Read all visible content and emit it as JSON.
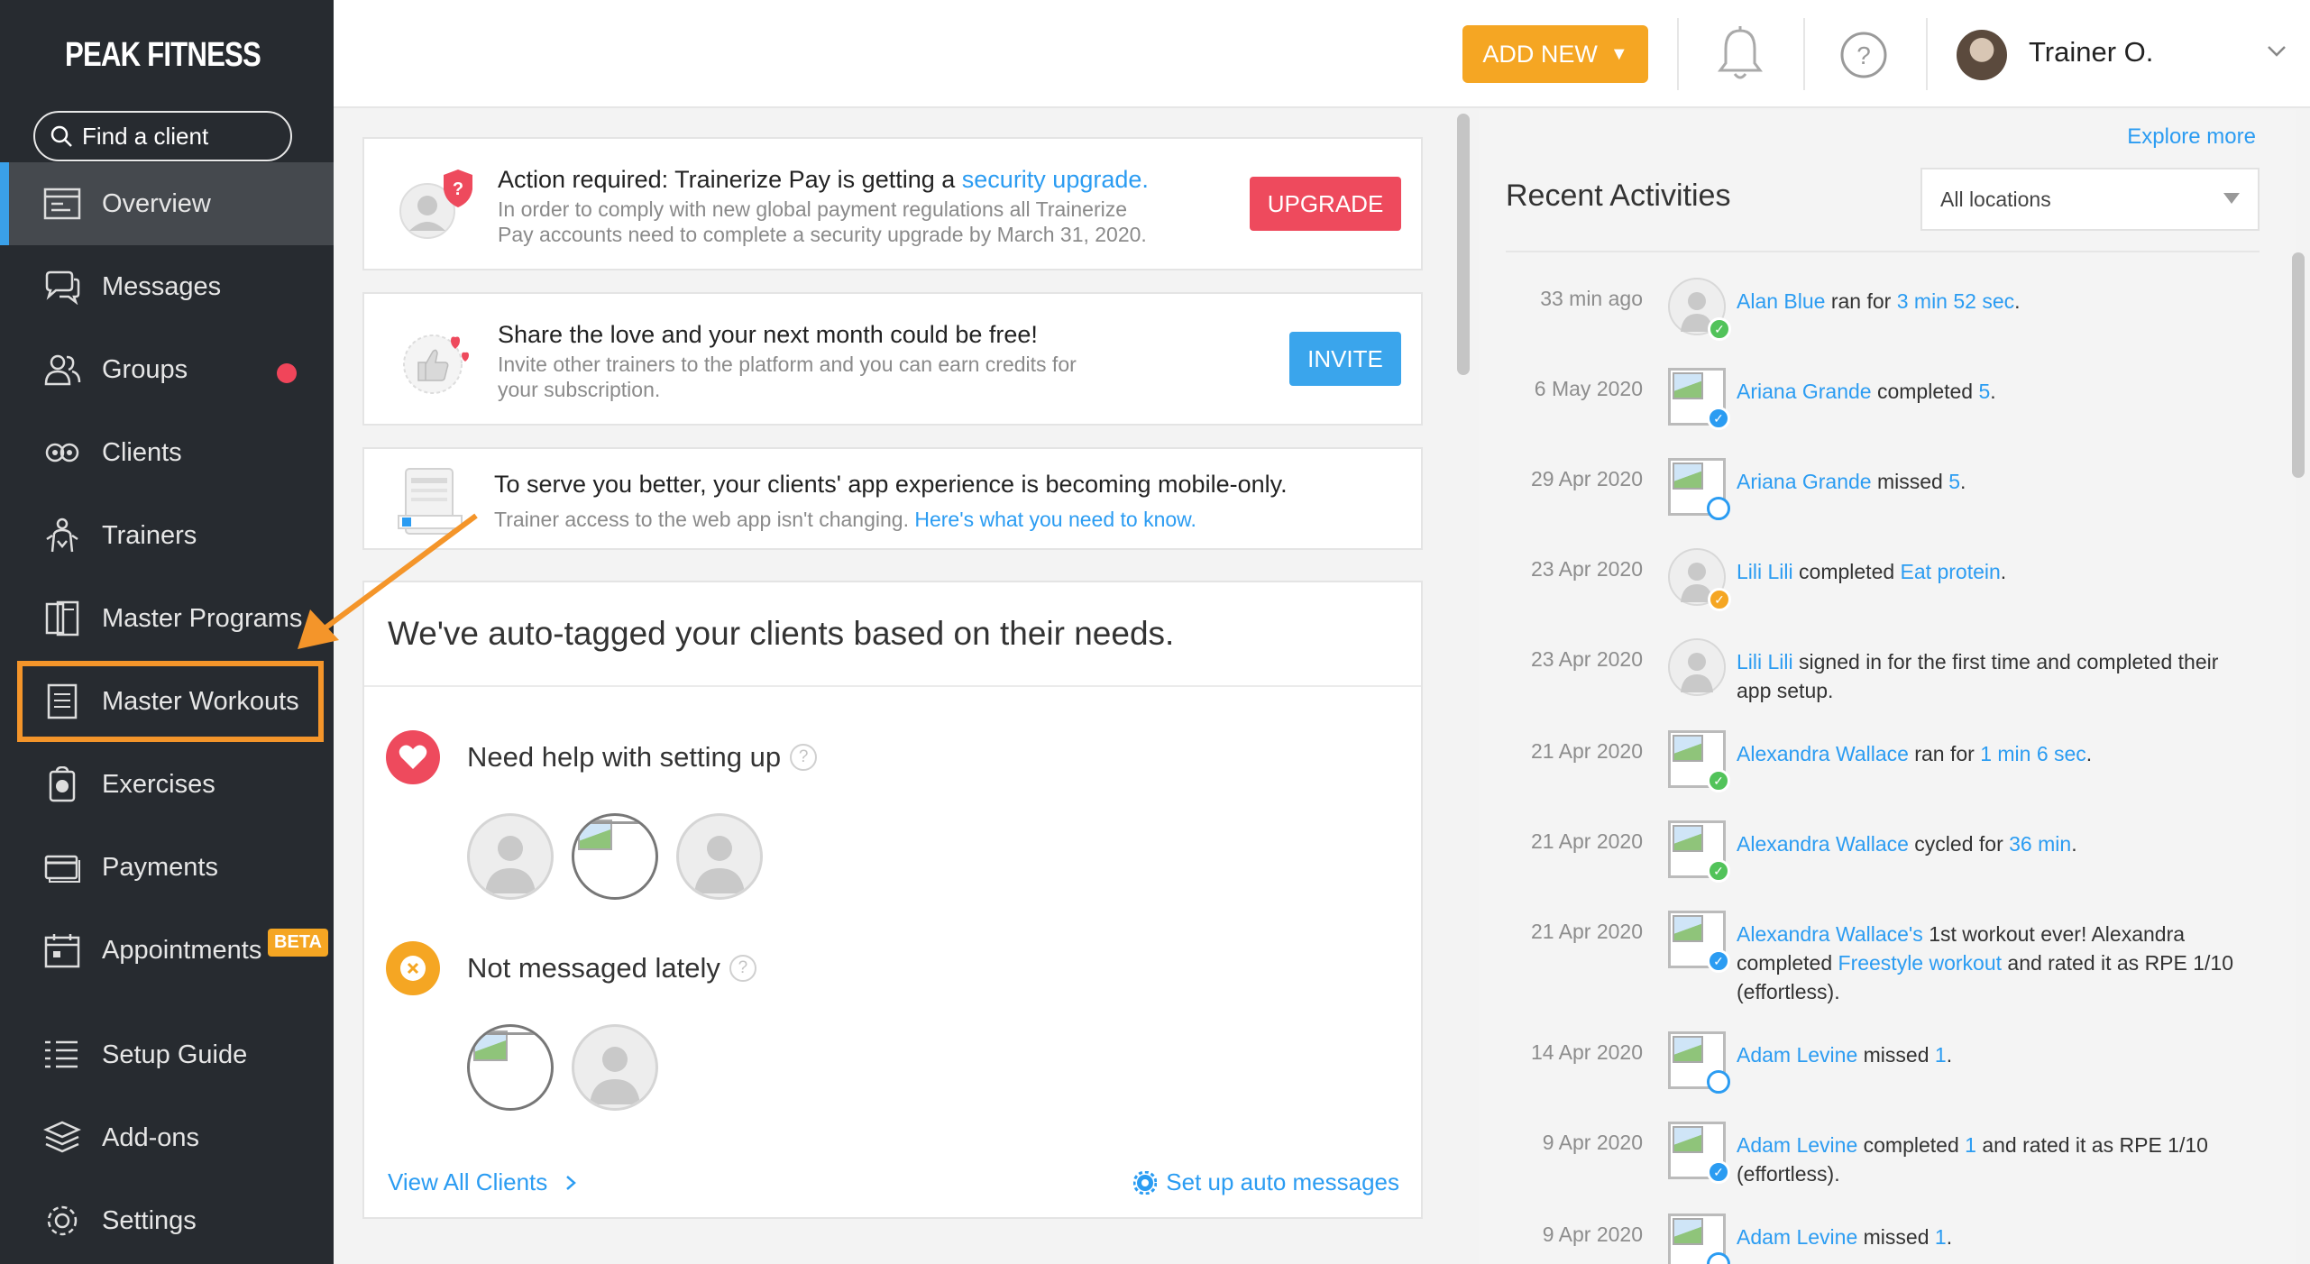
{
  "brand": {
    "name": "PEAK FITNESS",
    "color": "#e8423a"
  },
  "search": {
    "placeholder": "Find a client"
  },
  "sidebar": {
    "items": [
      {
        "label": "Overview",
        "icon": "overview-icon",
        "active": true
      },
      {
        "label": "Messages",
        "icon": "messages-icon"
      },
      {
        "label": "Groups",
        "icon": "groups-icon",
        "badge": "red-dot"
      },
      {
        "label": "Clients",
        "icon": "clients-icon"
      },
      {
        "label": "Trainers",
        "icon": "trainers-icon"
      },
      {
        "label": "Master Programs",
        "icon": "master-programs-icon"
      },
      {
        "label": "Master Workouts",
        "icon": "master-workouts-icon",
        "highlighted": true
      },
      {
        "label": "Exercises",
        "icon": "exercises-icon"
      },
      {
        "label": "Payments",
        "icon": "payments-icon"
      },
      {
        "label": "Appointments",
        "icon": "appointments-icon",
        "tag": "BETA"
      },
      {
        "label": "Setup Guide",
        "icon": "setup-guide-icon"
      },
      {
        "label": "Add-ons",
        "icon": "add-ons-icon"
      },
      {
        "label": "Settings",
        "icon": "settings-icon"
      }
    ]
  },
  "header": {
    "add_new": "ADD NEW",
    "user_name": "Trainer O."
  },
  "cards": {
    "pay": {
      "title_prefix": "Action required: Trainerize Pay is getting a ",
      "title_link": "security upgrade.",
      "sub_line1": "In order to comply with new global payment regulations all Trainerize",
      "sub_line2": "Pay accounts need to complete a security upgrade by March 31, 2020.",
      "button": "UPGRADE"
    },
    "share": {
      "title": "Share the love and your next month could be free!",
      "sub_line1": "Invite other trainers to the platform and you can earn credits for",
      "sub_line2": "your subscription.",
      "button": "INVITE"
    },
    "mobile": {
      "title": "To serve you better, your clients' app experience is becoming mobile-only.",
      "sub_prefix": "Trainer access to the web app isn't changing. ",
      "sub_link": "Here's what you need to know."
    },
    "autotag": {
      "title": "We've auto-tagged your clients based on their needs.",
      "tag1": "Need help with setting up",
      "tag2": "Not messaged lately",
      "help": "?",
      "view_all": "View All Clients",
      "setup_auto": "Set up auto messages"
    }
  },
  "recent": {
    "explore": "Explore more",
    "title": "Recent Activities",
    "location": "All locations",
    "activities": [
      {
        "date": "33 min ago",
        "status": "green",
        "avatar": "photo",
        "parts": [
          [
            "Alan Blue",
            true
          ],
          [
            " ran for ",
            false
          ],
          [
            "3 min 52 sec",
            true
          ],
          [
            ".",
            false
          ]
        ]
      },
      {
        "date": "6 May 2020",
        "status": "blue",
        "avatar": "broken",
        "parts": [
          [
            "Ariana Grande",
            true
          ],
          [
            " completed ",
            false
          ],
          [
            "5",
            true
          ],
          [
            ".",
            false
          ]
        ]
      },
      {
        "date": "29 Apr 2020",
        "status": "empty",
        "avatar": "broken",
        "parts": [
          [
            "Ariana Grande",
            true
          ],
          [
            " missed ",
            false
          ],
          [
            "5",
            true
          ],
          [
            ".",
            false
          ]
        ]
      },
      {
        "date": "23 Apr 2020",
        "status": "orange",
        "avatar": "photo",
        "parts": [
          [
            "Lili Lili",
            true
          ],
          [
            " completed ",
            false
          ],
          [
            "Eat protein",
            true
          ],
          [
            ".",
            false
          ]
        ]
      },
      {
        "date": "23 Apr 2020",
        "status": "none",
        "avatar": "photo",
        "parts": [
          [
            "Lili Lili",
            true
          ],
          [
            " signed in for the first time and completed their app setup.",
            false
          ]
        ]
      },
      {
        "date": "21 Apr 2020",
        "status": "green",
        "avatar": "broken",
        "parts": [
          [
            "Alexandra Wallace",
            true
          ],
          [
            " ran for ",
            false
          ],
          [
            "1 min 6 sec",
            true
          ],
          [
            ".",
            false
          ]
        ]
      },
      {
        "date": "21 Apr 2020",
        "status": "green",
        "avatar": "broken",
        "parts": [
          [
            "Alexandra Wallace",
            true
          ],
          [
            " cycled for ",
            false
          ],
          [
            "36 min",
            true
          ],
          [
            ".",
            false
          ]
        ]
      },
      {
        "date": "21 Apr 2020",
        "status": "blue",
        "avatar": "broken",
        "parts": [
          [
            "Alexandra Wallace's",
            true
          ],
          [
            " 1st workout ever! Alexandra completed ",
            false
          ],
          [
            "Freestyle workout",
            true
          ],
          [
            " and rated it as RPE 1/10 (effortless).",
            false
          ]
        ]
      },
      {
        "date": "14 Apr 2020",
        "status": "empty",
        "avatar": "broken",
        "parts": [
          [
            "Adam Levine",
            true
          ],
          [
            " missed ",
            false
          ],
          [
            "1",
            true
          ],
          [
            ".",
            false
          ]
        ]
      },
      {
        "date": "9 Apr 2020",
        "status": "blue",
        "avatar": "broken",
        "parts": [
          [
            "Adam Levine",
            true
          ],
          [
            " completed ",
            false
          ],
          [
            "1",
            true
          ],
          [
            " and rated it as RPE 1/10 (effortless).",
            false
          ]
        ]
      },
      {
        "date": "9 Apr 2020",
        "status": "empty",
        "avatar": "broken",
        "parts": [
          [
            "Adam Levine",
            true
          ],
          [
            " missed ",
            false
          ],
          [
            "1",
            true
          ],
          [
            ".",
            false
          ]
        ]
      }
    ]
  },
  "colors": {
    "accent": "#2b9cf2",
    "orange": "#f5a623",
    "red": "#ee4a5d",
    "sidebar": "#272b30"
  }
}
